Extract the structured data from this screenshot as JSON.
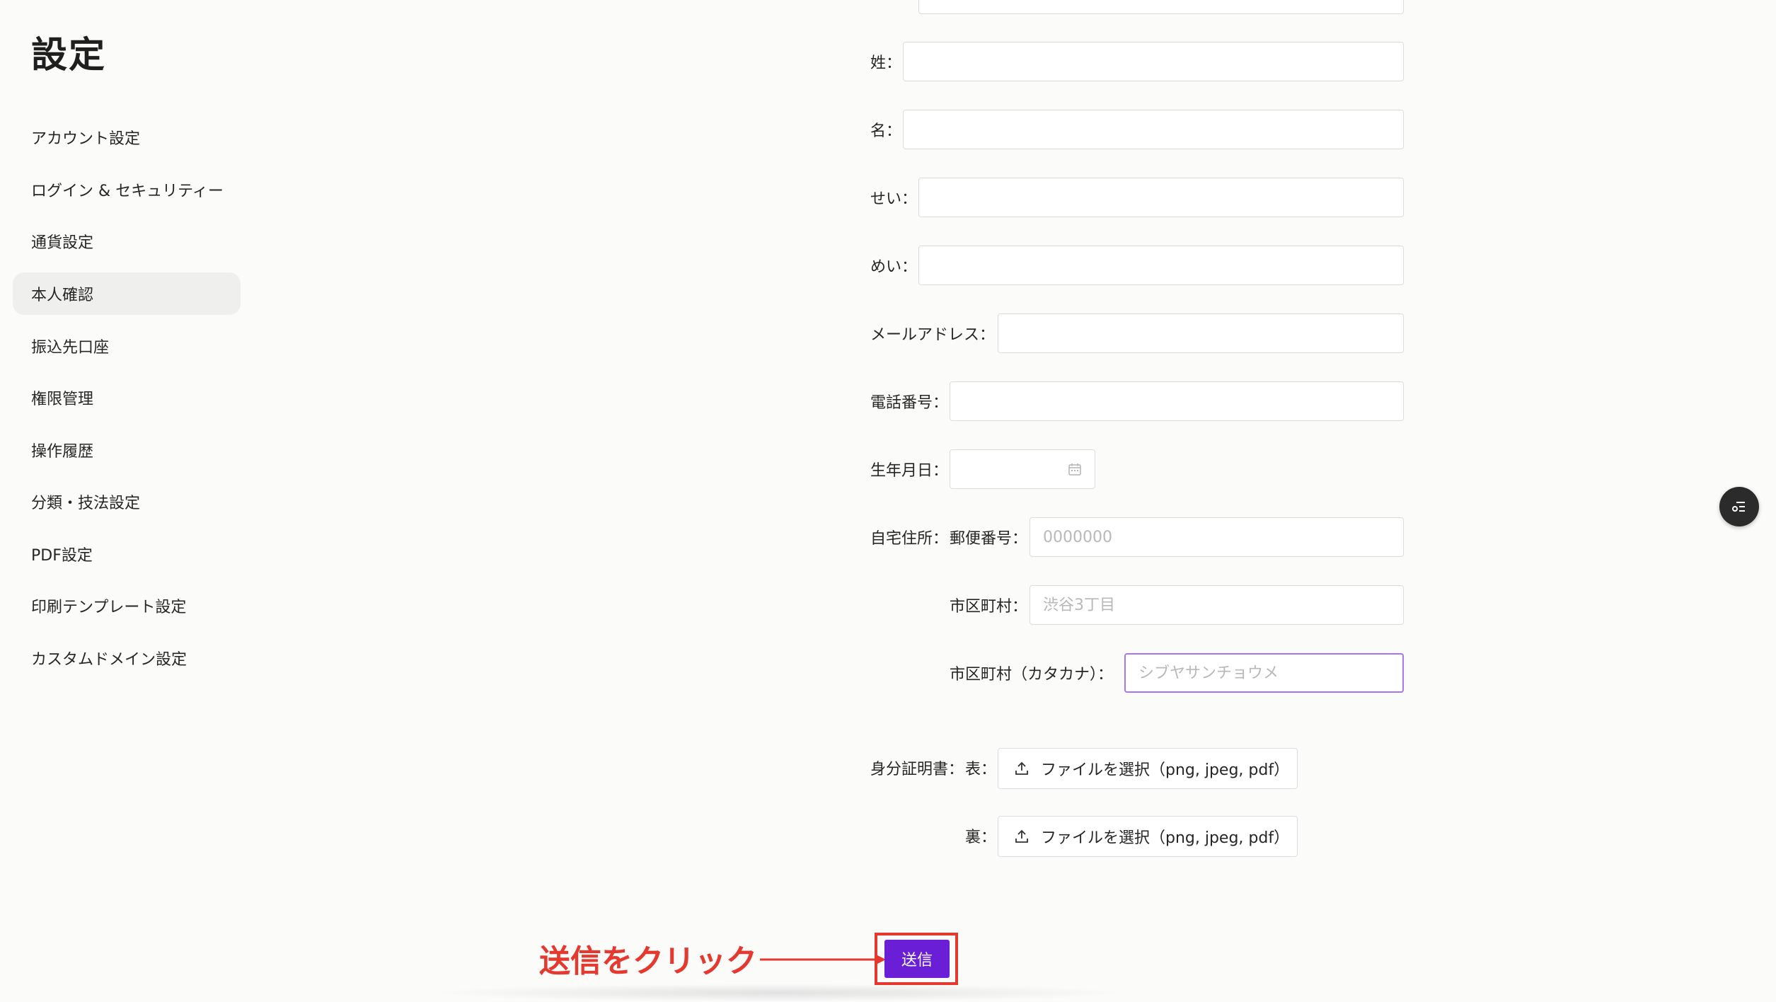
{
  "sidebar": {
    "title": "設定",
    "items": [
      {
        "label": "アカウント設定"
      },
      {
        "label": "ログイン & セキュリティー"
      },
      {
        "label": "通貨設定"
      },
      {
        "label": "本人確認",
        "active": true
      },
      {
        "label": "振込先口座"
      },
      {
        "label": "権限管理"
      },
      {
        "label": "操作履歴"
      },
      {
        "label": "分類・技法設定"
      },
      {
        "label": "PDF設定"
      },
      {
        "label": "印刷テンプレート設定"
      },
      {
        "label": "カスタムドメイン設定"
      }
    ]
  },
  "form": {
    "last_name_label": "姓：",
    "first_name_label": "名：",
    "last_name_kana_label": "せい：",
    "first_name_kana_label": "めい：",
    "email_label": "メールアドレス：",
    "phone_label": "電話番号：",
    "birthdate_label": "生年月日：",
    "address_label": "自宅住所：",
    "postal_label": "郵便番号：",
    "postal_placeholder": "0000000",
    "city_label": "市区町村：",
    "city_placeholder": "渋谷3丁目",
    "city_kana_label": "市区町村（カタカナ）：",
    "city_kana_placeholder": "シブヤサンチョウメ",
    "id_doc_label": "身分証明書：",
    "front_label": "表：",
    "back_label": "裏：",
    "upload_label": "ファイルを選択（png, jpeg, pdf）",
    "submit_label": "送信"
  },
  "annotation": {
    "text": "送信をクリック",
    "color": "#e5382f"
  },
  "colors": {
    "accent": "#6a1fd6",
    "focus_border": "#a974f0",
    "annotation": "#e5382f"
  },
  "icons": {
    "calendar": "calendar-icon",
    "upload": "upload-icon",
    "floating": "checklist-icon"
  }
}
